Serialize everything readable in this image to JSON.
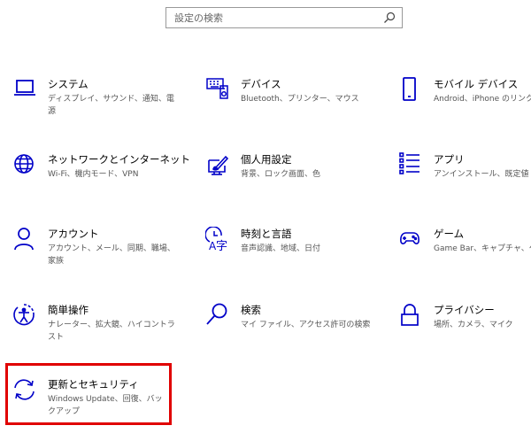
{
  "search": {
    "placeholder": "設定の検索"
  },
  "tiles": [
    {
      "title": "システム",
      "desc": "ディスプレイ、サウンド、通知、電源"
    },
    {
      "title": "デバイス",
      "desc": "Bluetooth、プリンター、マウス"
    },
    {
      "title": "モバイル デバイス",
      "desc": "Android、iPhone のリンク"
    },
    {
      "title": "ネットワークとインターネット",
      "desc": "Wi-Fi、機内モード、VPN"
    },
    {
      "title": "個人用設定",
      "desc": "背景、ロック画面、色"
    },
    {
      "title": "アプリ",
      "desc": "アンインストール、既定値"
    },
    {
      "title": "アカウント",
      "desc": "アカウント、メール、同期、職場、家族"
    },
    {
      "title": "時刻と言語",
      "desc": "音声認識、地域、日付"
    },
    {
      "title": "ゲーム",
      "desc": "Game Bar、キャプチャ、ゲー"
    },
    {
      "title": "簡単操作",
      "desc": "ナレーター、拡大鏡、ハイコントラスト"
    },
    {
      "title": "検索",
      "desc": "マイ ファイル、アクセス許可の検索"
    },
    {
      "title": "プライバシー",
      "desc": "場所、カメラ、マイク"
    },
    {
      "title": "更新とセキュリティ",
      "desc": "Windows Update、回復、バックアップ"
    }
  ],
  "colors": {
    "accent": "#0000c8",
    "highlight": "#e00000"
  }
}
